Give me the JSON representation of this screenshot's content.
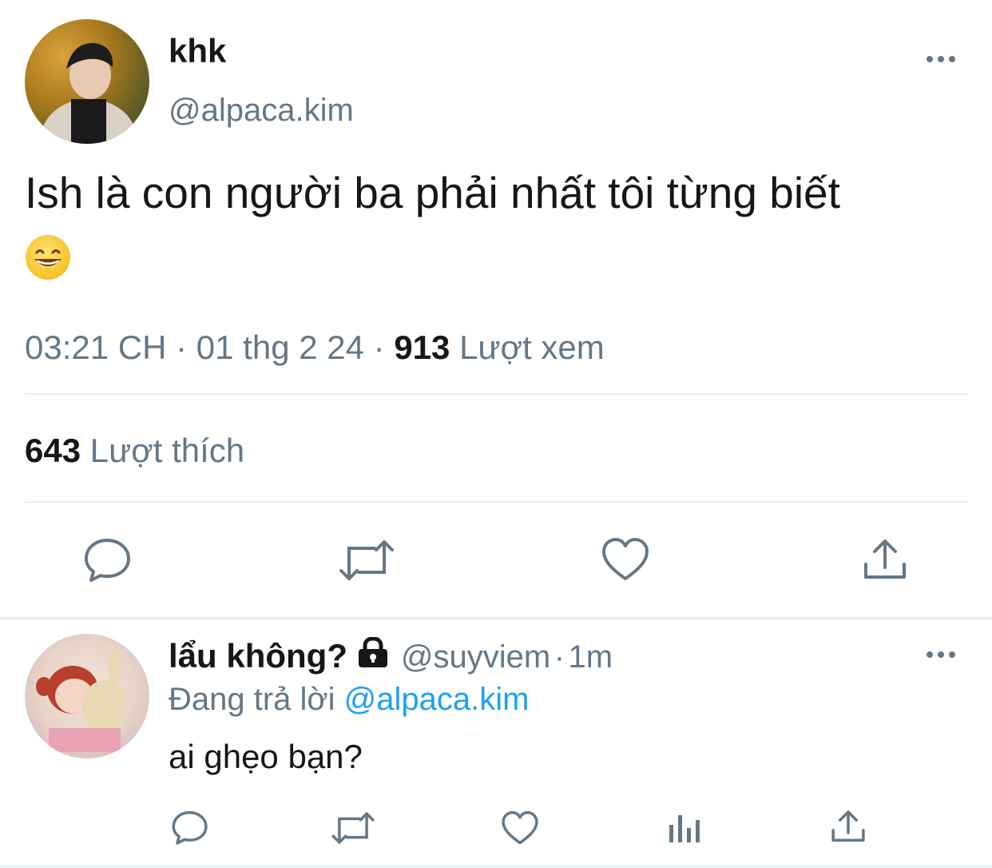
{
  "tweet": {
    "author_name": "khk",
    "author_handle": "@alpaca.kim",
    "text": "Ish là con người ba phải nhất tôi từng biết",
    "emoji": "😁",
    "time": "03:21 CH",
    "separator1": "·",
    "date": "01 thg 2 24",
    "separator2": "·",
    "views_count": "913",
    "views_label": "Lượt xem",
    "likes_count": "643",
    "likes_label": "Lượt thích",
    "actions": [
      "reply-icon",
      "retweet-icon",
      "like-icon",
      "share-icon"
    ]
  },
  "reply": {
    "author_name": "lẩu không?",
    "lock_icon": "lock-icon",
    "author_handle": "@suyviem",
    "separator": "·",
    "time": "1m",
    "replying_label": "Đang trả lời",
    "replying_to": "@alpaca.kim",
    "text": "ai ghẹo bạn?",
    "actions": [
      "reply-icon",
      "retweet-icon",
      "like-icon",
      "analytics-icon",
      "share-icon"
    ]
  },
  "colors": {
    "text_primary": "#14171a",
    "text_secondary": "#657786",
    "link": "#1da1f2",
    "divider": "#e6ecf0"
  }
}
